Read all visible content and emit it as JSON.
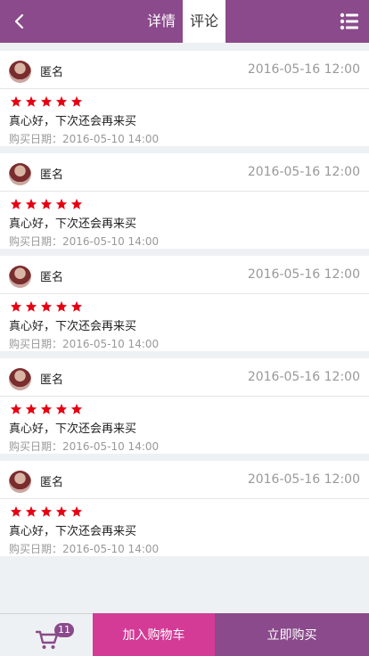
{
  "header": {
    "tabs": [
      {
        "label": "详情",
        "active": false
      },
      {
        "label": "评论",
        "active": true
      }
    ],
    "back_icon": "chevron-left-icon",
    "menu_icon": "list-menu-icon",
    "bg_color": "#8a4a8b"
  },
  "reviews": [
    {
      "user": "匿名",
      "date": "2016-05-16 12:00",
      "rating": 5,
      "comment": "真心好，下次还会再来买",
      "purchase_date": "购买日期：2016-05-10 14:00"
    },
    {
      "user": "匿名",
      "date": "2016-05-16 12:00",
      "rating": 5,
      "comment": "真心好，下次还会再来买",
      "purchase_date": "购买日期：2016-05-10 14:00"
    },
    {
      "user": "匿名",
      "date": "2016-05-16 12:00",
      "rating": 5,
      "comment": "真心好，下次还会再来买",
      "purchase_date": "购买日期：2016-05-10 14:00"
    },
    {
      "user": "匿名",
      "date": "2016-05-16 12:00",
      "rating": 5,
      "comment": "真心好，下次还会再来买",
      "purchase_date": "购买日期：2016-05-10 14:00"
    },
    {
      "user": "匿名",
      "date": "2016-05-16 12:00",
      "rating": 5,
      "comment": "真心好，下次还会再来买",
      "purchase_date": "购买日期：2016-05-10 14:00"
    }
  ],
  "footer": {
    "cart_icon": "shopping-cart-icon",
    "cart_count": "11",
    "add_to_cart_label": "加入购物车",
    "buy_now_label": "立即购买",
    "add_color": "#d33b96",
    "buy_color": "#8a4a8b"
  },
  "star_color": "#e60012"
}
